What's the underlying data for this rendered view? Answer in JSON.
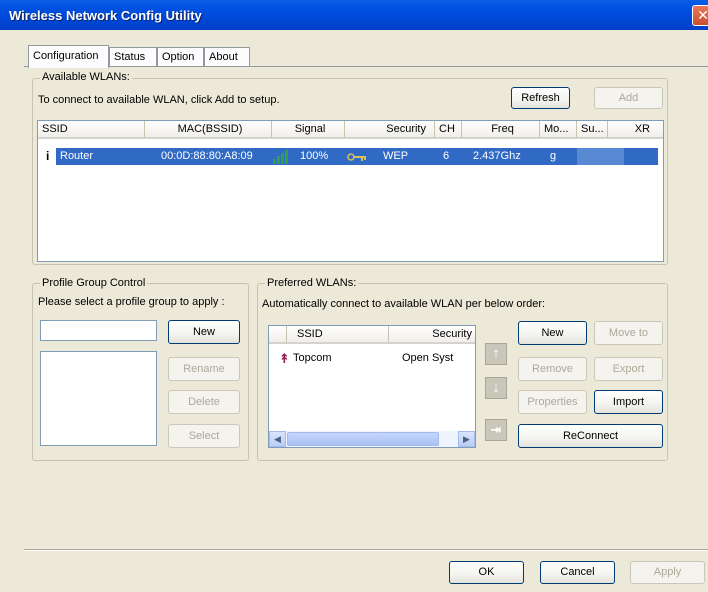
{
  "window": {
    "title": "Wireless Network Config Utility",
    "close_glyph": "✕"
  },
  "tabs": [
    {
      "label": "Configuration"
    },
    {
      "label": "Status"
    },
    {
      "label": "Option"
    },
    {
      "label": "About"
    }
  ],
  "available": {
    "legend": "Available WLANs:",
    "hint": "To connect to available WLAN, click Add to setup.",
    "refresh_label": "Refresh",
    "add_label": "Add",
    "columns": [
      "SSID",
      "MAC(BSSID)",
      "Signal",
      "Security",
      "CH",
      "Freq",
      "Mo...",
      "Su...",
      "XR"
    ],
    "rows": [
      {
        "ssid": "Router",
        "mac": "00:0D:88:80:A8:09",
        "signal": "100%",
        "security": "WEP",
        "ch": "6",
        "freq": "2.437Ghz",
        "mode": "g",
        "su": "",
        "xr": ""
      }
    ]
  },
  "profile": {
    "legend": "Profile Group Control",
    "hint": "Please select a profile group to apply :",
    "name_value": "",
    "new_label": "New",
    "rename_label": "Rename",
    "delete_label": "Delete",
    "select_label": "Select"
  },
  "preferred": {
    "legend": "Preferred WLANs:",
    "hint": "Automatically connect to available WLAN per below order:",
    "columns": [
      "SSID",
      "Security"
    ],
    "rows": [
      {
        "ssid": "Topcom",
        "security": "Open Syst"
      }
    ],
    "new_label": "New",
    "move_to_label": "Move to",
    "remove_label": "Remove",
    "export_label": "Export",
    "properties_label": "Properties",
    "import_label": "Import",
    "reconnect_label": "ReConnect"
  },
  "footer": {
    "ok_label": "OK",
    "cancel_label": "Cancel",
    "apply_label": "Apply"
  },
  "colors": {
    "selection": "#316ac5",
    "titlebar": "#0054e3",
    "face": "#ece9d8"
  }
}
